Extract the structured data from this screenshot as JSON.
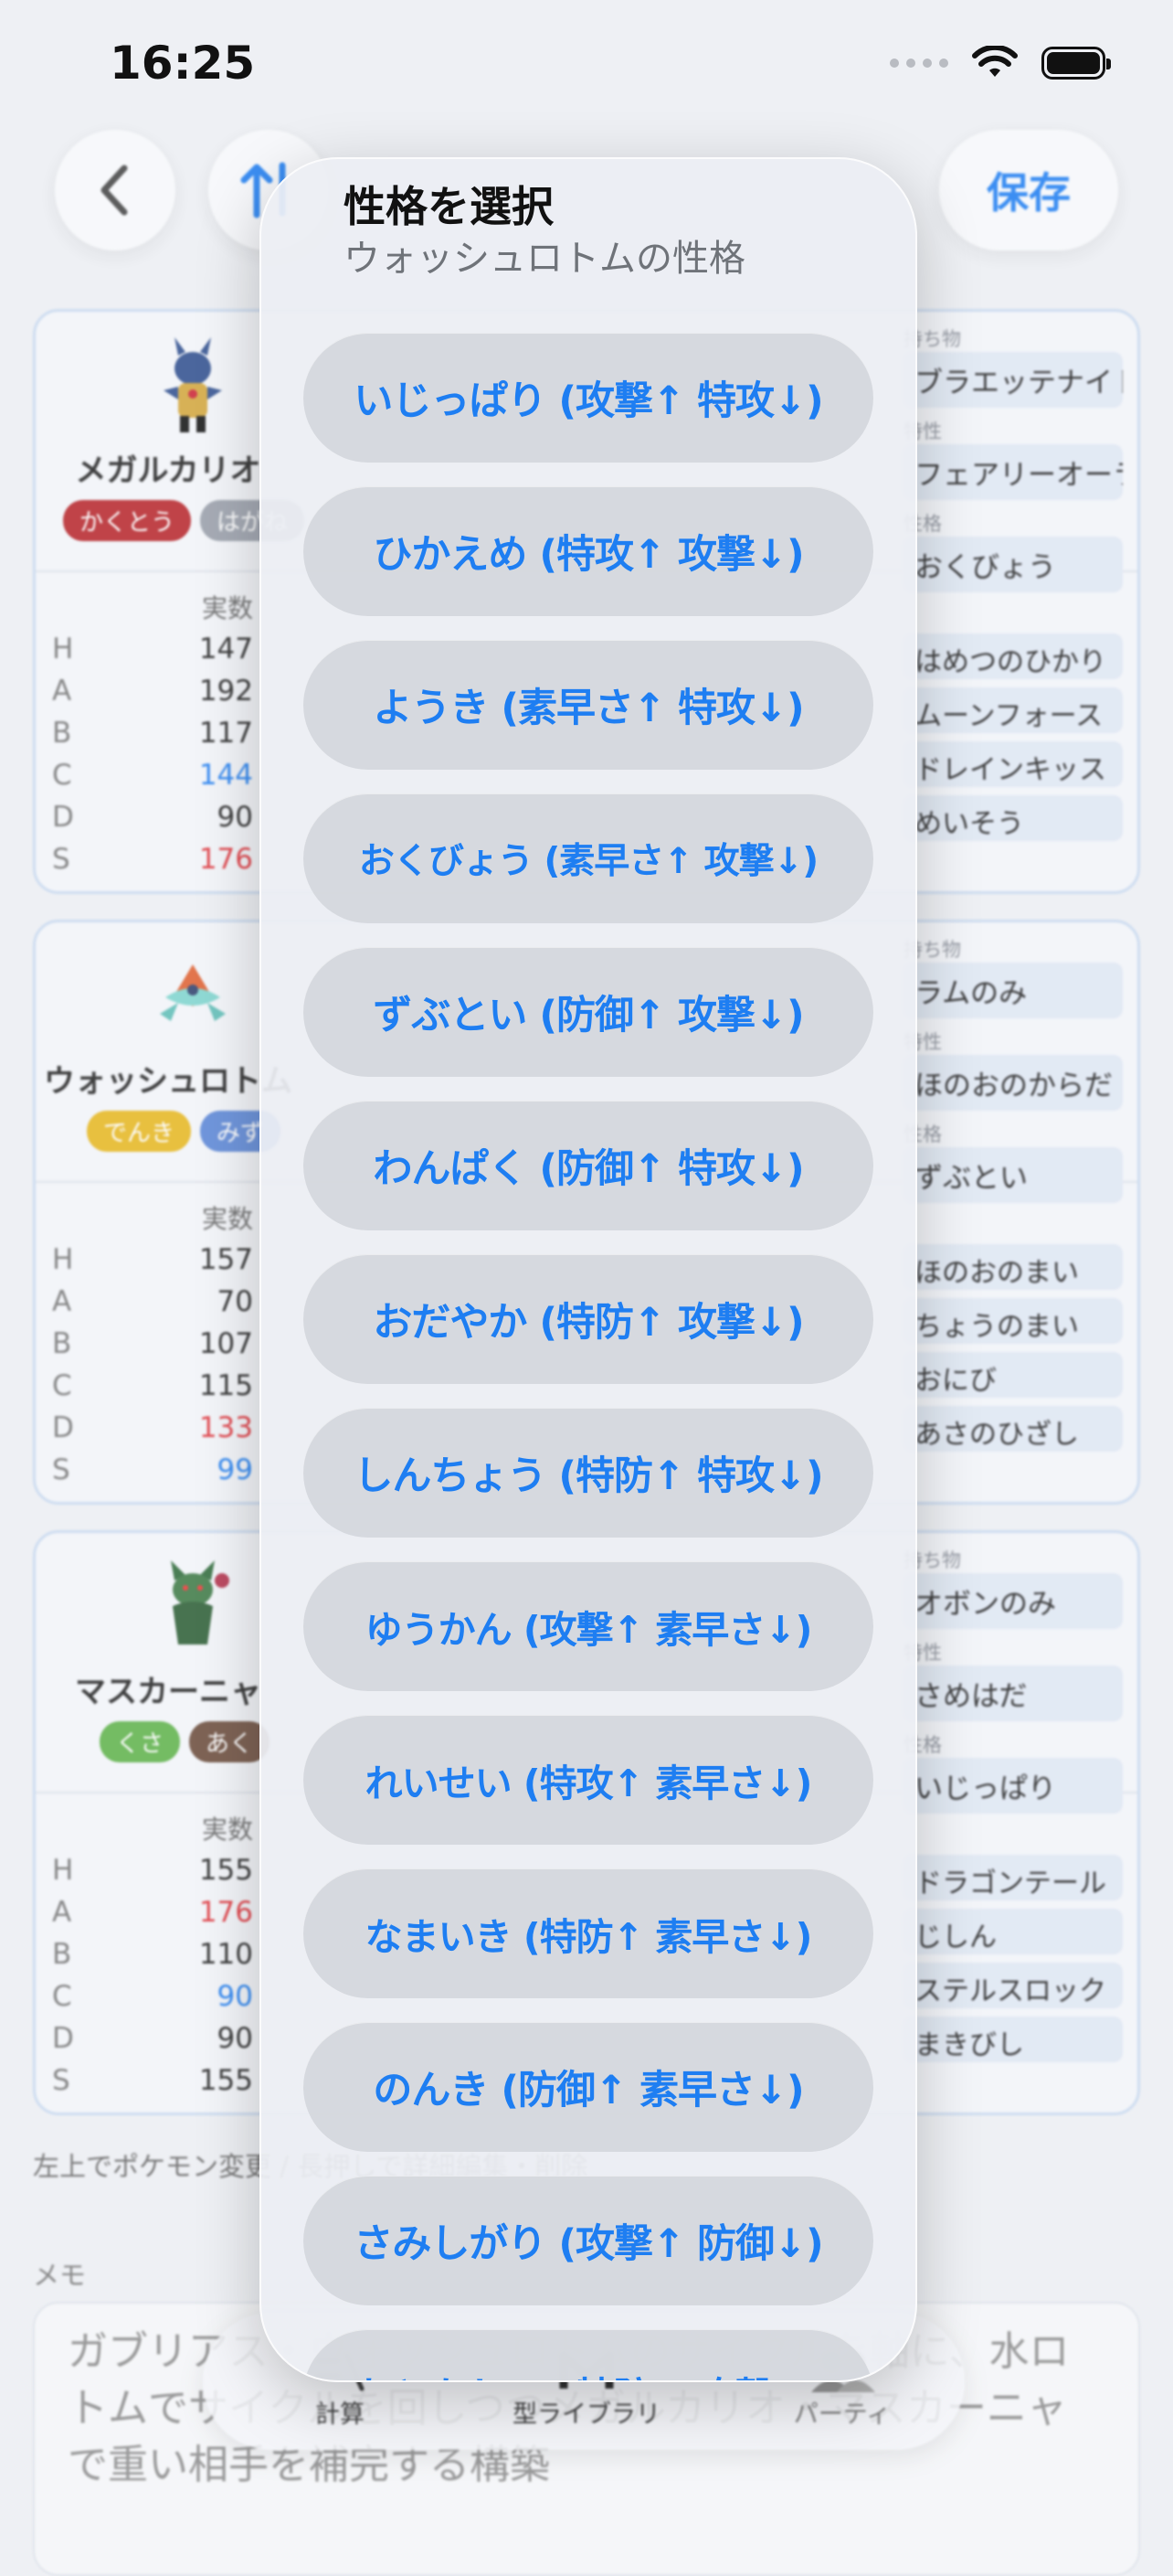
{
  "status": {
    "time": "16:25"
  },
  "nav": {
    "save_label": "保存"
  },
  "cards": [
    {
      "name": "メガルカリオ",
      "types": [
        {
          "label": "かくとう",
          "color": "#b8262b"
        },
        {
          "label": "はがね",
          "color": "#9aa0ab"
        }
      ],
      "item_label": "持ち物",
      "item": "ブラエッテナイト",
      "ability_label": "特性",
      "ability": "フェアリーオーラ",
      "nature_label": "性格",
      "nature": "おくびょう",
      "stat_header": "実数",
      "stats": [
        {
          "key": "H",
          "val": "147",
          "color": "#222"
        },
        {
          "key": "A",
          "val": "192",
          "color": "#222"
        },
        {
          "key": "B",
          "val": "117",
          "color": "#222"
        },
        {
          "key": "C",
          "val": "144",
          "color": "#1e7ef2"
        },
        {
          "key": "D",
          "val": "90",
          "color": "#222"
        },
        {
          "key": "S",
          "val": "176",
          "color": "#e0333a"
        }
      ],
      "moves": [
        "はめつのひかり",
        "ムーンフォース",
        "ドレインキッス",
        "めいそう"
      ]
    },
    {
      "name": "ウォッシュロトム",
      "types": [
        {
          "label": "でんき",
          "color": "#e8b820"
        },
        {
          "label": "みず",
          "color": "#5b87d8"
        }
      ],
      "item_label": "持ち物",
      "item": "ラムのみ",
      "ability_label": "特性",
      "ability": "ほのおのからだ",
      "nature_label": "性格",
      "nature": "ずぶとい",
      "stat_header": "実数",
      "stats": [
        {
          "key": "H",
          "val": "157",
          "color": "#222"
        },
        {
          "key": "A",
          "val": "70",
          "color": "#222"
        },
        {
          "key": "B",
          "val": "107",
          "color": "#222"
        },
        {
          "key": "C",
          "val": "115",
          "color": "#222"
        },
        {
          "key": "D",
          "val": "133",
          "color": "#e0333a"
        },
        {
          "key": "S",
          "val": "99",
          "color": "#1e7ef2"
        }
      ],
      "moves": [
        "ほのおのまい",
        "ちょうのまい",
        "おにび",
        "あさのひざし"
      ]
    },
    {
      "name": "マスカーニャ",
      "types": [
        {
          "label": "くさ",
          "color": "#5fb34a"
        },
        {
          "label": "あく",
          "color": "#6b4b3a"
        }
      ],
      "item_label": "持ち物",
      "item": "オボンのみ",
      "ability_label": "特性",
      "ability": "さめはだ",
      "nature_label": "性格",
      "nature": "いじっぱり",
      "stat_header": "実数",
      "stats": [
        {
          "key": "H",
          "val": "155",
          "color": "#222"
        },
        {
          "key": "A",
          "val": "176",
          "color": "#e0333a"
        },
        {
          "key": "B",
          "val": "110",
          "color": "#222"
        },
        {
          "key": "C",
          "val": "90",
          "color": "#1e7ef2"
        },
        {
          "key": "D",
          "val": "90",
          "color": "#222"
        },
        {
          "key": "S",
          "val": "155",
          "color": "#222"
        }
      ],
      "moves": [
        "ドラゴンテール",
        "じしん",
        "ステルスロック",
        "まきびし"
      ]
    }
  ],
  "footer_note": "左上でポケモン変更 / 長押しで詳細編集・削除",
  "memo_label": "メモ",
  "memo_text": "ガブリアス・ウォッシュロトムのサイクルを軸に、水ロトムでサイクルを回しつつメガルカリオ・マスカーニャで重い相手を補完する構築",
  "tabs": {
    "calc": "計算",
    "library": "型ライブラリ",
    "party": "パーティ"
  },
  "sheet": {
    "title": "性格を選択",
    "subtitle": "ウォッシュロトムの性格",
    "options": [
      "いじっぱり (攻撃↑ 特攻↓)",
      "ひかえめ (特攻↑ 攻撃↓)",
      "ようき (素早さ↑ 特攻↓)",
      "おくびょう (素早さ↑ 攻撃↓)",
      "ずぶとい (防御↑ 攻撃↓)",
      "わんぱく (防御↑ 特攻↓)",
      "おだやか (特防↑ 攻撃↓)",
      "しんちょう (特防↑ 特攻↓)",
      "ゆうかん (攻撃↑ 素早さ↓)",
      "れいせい (特攻↑ 素早さ↓)",
      "なまいき (特防↑ 素早さ↓)",
      "のんき (防御↑ 素早さ↓)",
      "さみしがり (攻撃↑ 防御↓)",
      "おとなしい (特防↑ 攻撃↓)"
    ]
  }
}
